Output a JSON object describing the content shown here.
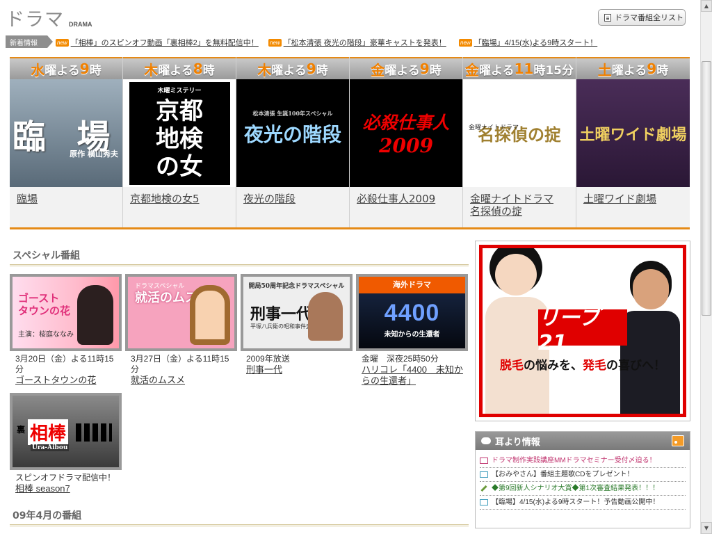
{
  "header": {
    "title": "ドラマ",
    "subtitle": "DRAMA",
    "list_button": "ドラマ番組全リスト"
  },
  "news": {
    "label": "新着情報",
    "badge": "new",
    "items": [
      "「相棒」のスピンオフ動画「裏相棒2」を無料配信中！",
      "「松本清張 夜光の階段」豪華キャストを発表！",
      "「臨場」4/15(水)よる9時スタート！"
    ]
  },
  "weekly": [
    {
      "day": "水",
      "rest": "曜よる",
      "time": "9",
      "unit": "時",
      "thumb_main": "臨 場",
      "thumb_sub": "原作 横山秀夫",
      "name": "臨場"
    },
    {
      "day": "木",
      "rest": "曜よる",
      "time": "8",
      "unit": "時",
      "thumb_main": "京都\n地検\nの女",
      "thumb_sub": "木曜ミステリー",
      "name": "京都地検の女5"
    },
    {
      "day": "木",
      "rest": "曜よる",
      "time": "9",
      "unit": "時",
      "thumb_main": "夜光の階段",
      "thumb_sub": "松本清張 生誕100年スペシャル",
      "name": "夜光の階段"
    },
    {
      "day": "金",
      "rest": "曜よる",
      "time": "9",
      "unit": "時",
      "thumb_main": "必殺仕事人",
      "thumb_sub": "2009",
      "name": "必殺仕事人2009"
    },
    {
      "day": "金",
      "rest": "曜よる",
      "time": "11",
      "unit": "時15分",
      "thumb_main": "名探偵の掟",
      "thumb_sub": "金曜ナイトドラマ",
      "name": "金曜ナイトドラマ\n名探偵の掟"
    },
    {
      "day": "土",
      "rest": "曜よる",
      "time": "9",
      "unit": "時",
      "thumb_main": "土曜ワイド劇場",
      "thumb_sub": "",
      "name": "土曜ワイド劇場"
    }
  ],
  "specials_heading": "スペシャル番組",
  "specials": [
    {
      "thumb_main": "ゴースト\nタウンの花",
      "thumb_sub": "主演：桜庭ななみ",
      "meta": "3月20日（金）よる11時15分",
      "link": "ゴーストタウンの花"
    },
    {
      "thumb_main": "就活のムスメ",
      "thumb_sub": "ドラマスペシャル",
      "meta": "3月27日（金）よる11時15分",
      "link": "就活のムスメ"
    },
    {
      "thumb_main": "刑事一代",
      "thumb_sub": "平塚八兵衛の昭和事件史",
      "thumb_top": "開局50周年記念ドラマスペシャル",
      "meta": "2009年放送",
      "link": "刑事一代"
    },
    {
      "thumb_band": "海外ドラマ",
      "thumb_main": "4400",
      "thumb_sub": "未知からの生還者",
      "meta": "金曜　深夜25時50分",
      "link": "ハリコレ「4400　未知からの生還者」"
    },
    {
      "thumb_main": "相棒",
      "thumb_sub": "Ura-Aibou",
      "thumb_prefix": "裏",
      "meta": "スピンオフドラマ配信中！",
      "link": "相棒 season7"
    }
  ],
  "april_heading": "09年4月の番組",
  "ad": {
    "logo": "リーブ21",
    "copy_a": "脱毛",
    "copy_b": "の悩みを、",
    "copy_c": "発毛",
    "copy_d": "の喜びへ！"
  },
  "info": {
    "title": "耳より情報",
    "items": [
      "ドラマ制作実践講座MMドラマセミナー受付〆迫る！",
      "【おみやさん】番組主題歌CDをプレゼント！",
      "◆第9回新人シナリオ大賞◆第1次審査結果発表！！！",
      "【臨場】4/15(水)よる9時スタート！予告動画公開中！"
    ]
  },
  "colors": {
    "accent_orange": "#f08000",
    "ad_red": "#e00000",
    "info_pink": "#c0336e"
  }
}
